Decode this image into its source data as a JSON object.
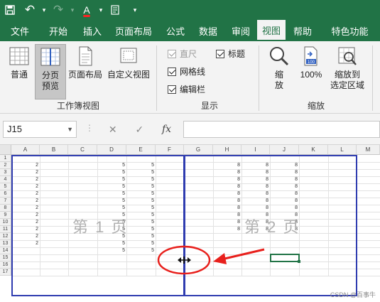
{
  "qat": {
    "save": "💾",
    "undo": "↶",
    "redo": "↷",
    "font_color_letter": "A",
    "more": "▾"
  },
  "tabs": [
    "文件",
    "开始",
    "插入",
    "页面布局",
    "公式",
    "数据",
    "审阅",
    "视图",
    "帮助",
    "特色功能"
  ],
  "active_tab": "视图",
  "ribbon": {
    "workbook_views": {
      "label": "工作簿视图",
      "normal": "普通",
      "page_break_1": "分页",
      "page_break_2": "预览",
      "page_layout": "页面布局",
      "custom_view": "自定义视图"
    },
    "show": {
      "label": "显示",
      "ruler": "直尺",
      "gridlines": "网格线",
      "formula_bar": "编辑栏",
      "headings": "标题"
    },
    "zoom": {
      "label": "缩放",
      "zoom_1": "缩",
      "zoom_2": "放",
      "hundred": "100%",
      "selection_1": "缩放到",
      "selection_2": "选定区域"
    }
  },
  "formula_bar": {
    "name_box": "J15",
    "cancel": "✕",
    "enter": "✓",
    "fx": "fx",
    "value": ""
  },
  "columns": [
    "A",
    "B",
    "C",
    "D",
    "E",
    "F",
    "G",
    "H",
    "I",
    "J",
    "K",
    "L",
    "M"
  ],
  "rows": [
    "1",
    "2",
    "3",
    "4",
    "5",
    "6",
    "7",
    "8",
    "9",
    "10",
    "11",
    "12",
    "13",
    "14",
    "15",
    "16",
    "17"
  ],
  "sheet_values": {
    "col_a": [
      "",
      "2",
      "2",
      "2",
      "2",
      "2",
      "2",
      "2",
      "2",
      "2",
      "2",
      "2",
      "2",
      "",
      "",
      "",
      ""
    ],
    "col_d": [
      "",
      "5",
      "5",
      "5",
      "5",
      "5",
      "5",
      "5",
      "5",
      "5",
      "5",
      "5",
      "5",
      "5",
      "",
      "",
      ""
    ],
    "col_e": [
      "",
      "5",
      "5",
      "5",
      "5",
      "5",
      "5",
      "5",
      "5",
      "5",
      "5",
      "5",
      "5",
      "5",
      "",
      "",
      ""
    ],
    "col_h": [
      "",
      "8",
      "8",
      "8",
      "8",
      "8",
      "8",
      "8",
      "8",
      "8",
      "8",
      "",
      "",
      "",
      "",
      "",
      ""
    ],
    "col_i": [
      "",
      "8",
      "8",
      "8",
      "8",
      "8",
      "8",
      "8",
      "8",
      "8",
      "8",
      "",
      "",
      "",
      "",
      "",
      ""
    ],
    "col_j": [
      "",
      "8",
      "8",
      "8",
      "8",
      "8",
      "8",
      "8",
      "8",
      "8",
      "8",
      "",
      "",
      "",
      "",
      "",
      ""
    ]
  },
  "page_labels": [
    "第 1 页",
    "第 2 页"
  ],
  "watermark": "CSDN @百事牛",
  "colors": {
    "excel_green": "#217346",
    "page_break_blue": "#2f3cb0",
    "annotation_red": "#e8201c"
  }
}
